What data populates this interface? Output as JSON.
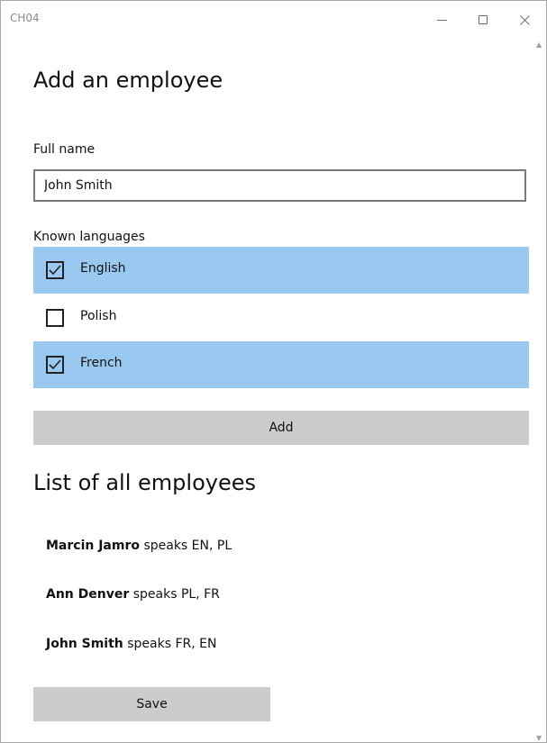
{
  "window": {
    "title": "CH04",
    "controls": {
      "minimize": "minimize-icon",
      "maximize": "maximize-icon",
      "close": "close-icon"
    }
  },
  "form": {
    "heading": "Add an employee",
    "full_name_label": "Full name",
    "full_name_value": "John Smith",
    "languages_label": "Known languages",
    "languages": [
      {
        "label": "English",
        "checked": true
      },
      {
        "label": "Polish",
        "checked": false
      },
      {
        "label": "French",
        "checked": true
      }
    ],
    "add_label": "Add"
  },
  "list": {
    "heading": "List of all employees",
    "employees": [
      {
        "name": "Marcin Jamro",
        "suffix": " speaks EN, PL"
      },
      {
        "name": "Ann Denver",
        "suffix": " speaks PL, FR"
      },
      {
        "name": "John Smith",
        "suffix": " speaks FR, EN"
      }
    ],
    "save_label": "Save"
  },
  "colors": {
    "selected_background": "#99c8f0",
    "button_background": "#cccccc"
  }
}
